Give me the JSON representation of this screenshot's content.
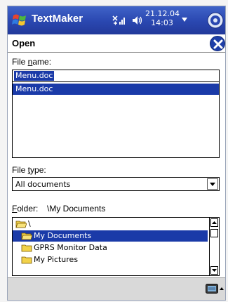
{
  "titlebar": {
    "app_title": "TextMaker",
    "clock_date": "21.12.04",
    "clock_time": "14:03"
  },
  "dialog": {
    "title": "Open"
  },
  "file_name": {
    "label_prefix": "File ",
    "label_accel": "n",
    "label_suffix": "ame:",
    "value": "Menu.doc",
    "suggestions": [
      "Menu.doc"
    ]
  },
  "file_type": {
    "label_prefix": "File ",
    "label_accel": "t",
    "label_suffix": "ype:",
    "selected": "All documents"
  },
  "folder": {
    "label_accel": "F",
    "label_suffix": "older:",
    "current": "\\My Documents",
    "tree": [
      {
        "label": "\\",
        "selected": false,
        "indent": 0
      },
      {
        "label": "My Documents",
        "selected": true,
        "indent": 1
      },
      {
        "label": "GPRS Monitor Data",
        "selected": false,
        "indent": 1
      },
      {
        "label": "My Pictures",
        "selected": false,
        "indent": 1
      }
    ]
  },
  "colors": {
    "selection": "#1a3aa8",
    "titlebar": "#2a47b0",
    "folder_yellow": "#f2d24a"
  },
  "icons": {
    "start": "windows-flag-icon",
    "signal": "signal-icon",
    "volume": "speaker-icon",
    "ok": "ok-orb-icon",
    "close": "close-icon",
    "keyboard": "keyboard-icon"
  }
}
